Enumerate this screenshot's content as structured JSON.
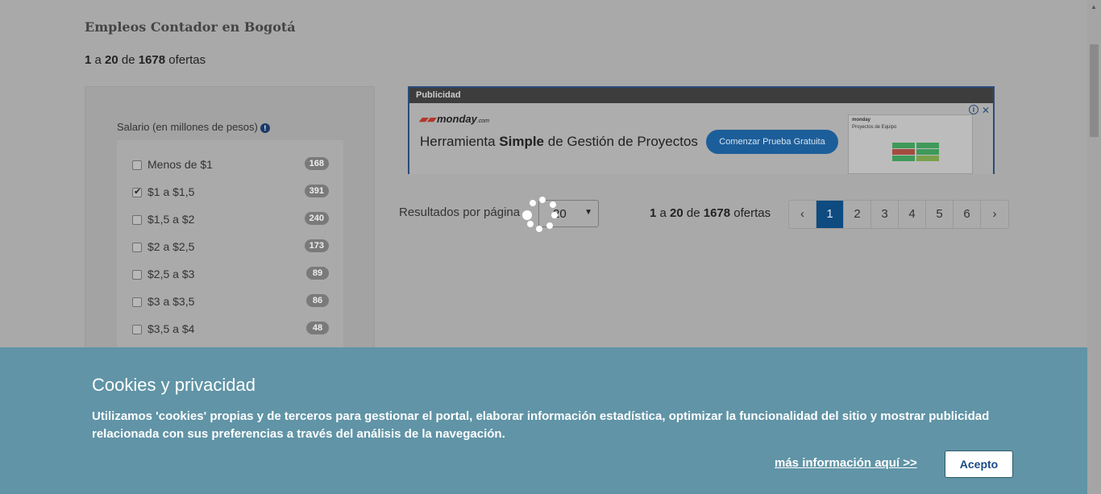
{
  "header": {
    "title": "Empleos Contador en Bogotá",
    "count": {
      "from": "1",
      "a": "a",
      "to": "20",
      "de": "de",
      "total": "1678",
      "unit": "ofertas"
    }
  },
  "filter": {
    "title": "Salario (en millones de pesos)",
    "info_icon": "info-icon",
    "items": [
      {
        "label": "Menos de $1",
        "count": "168",
        "checked": false
      },
      {
        "label": "$1 a $1,5",
        "count": "391",
        "checked": true
      },
      {
        "label": "$1,5 a $2",
        "count": "240",
        "checked": false
      },
      {
        "label": "$2 a $2,5",
        "count": "173",
        "checked": false
      },
      {
        "label": "$2,5 a $3",
        "count": "89",
        "checked": false
      },
      {
        "label": "$3 a $3,5",
        "count": "86",
        "checked": false
      },
      {
        "label": "$3,5 a $4",
        "count": "48",
        "checked": false
      }
    ]
  },
  "ad": {
    "header": "Publicidad",
    "logo_text": "monday",
    "logo_suffix": ".com",
    "headline_pre": "Herramienta ",
    "headline_bold": "Simple",
    "headline_post": " de Gestión de Proyectos",
    "cta": "Comenzar Prueba Gratuita",
    "preview_brand": "monday",
    "preview_title": "Proyectos de Equipo",
    "info_icon": "i",
    "close_icon": "✕"
  },
  "results": {
    "per_page_label": "Resultados por página",
    "per_page_value": "20",
    "count": {
      "from": "1",
      "a": "a",
      "to": "20",
      "de": "de",
      "total": "1678",
      "unit": "ofertas"
    }
  },
  "pagination": {
    "prev": "‹",
    "next": "›",
    "pages": [
      "1",
      "2",
      "3",
      "4",
      "5",
      "6"
    ],
    "active": "1"
  },
  "cookies": {
    "title": "Cookies y privacidad",
    "text": "Utilizamos 'cookies' propias y de terceros para gestionar el portal, elaborar información estadística, optimizar la funcionalidad del sitio y mostrar publicidad relacionada con sus preferencias a través del análisis de la navegación.",
    "more_link": "más información aquí >>",
    "accept": "Acepto"
  },
  "colors": {
    "cookie_bg": "#6094a6",
    "page_active": "#0d4b80",
    "overlay": "#a9a9a9"
  }
}
